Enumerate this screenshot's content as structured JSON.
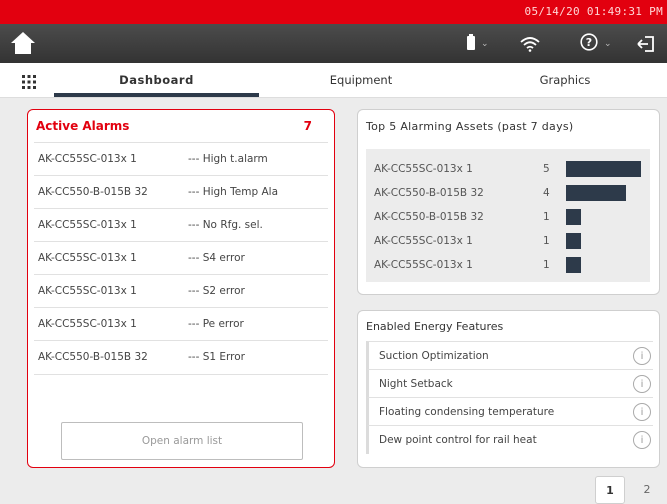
{
  "clock": "05/14/20 01:49:31 PM",
  "colors": {
    "brand_red": "#e2000f",
    "header_dark": "#3b3b3b",
    "bar_navy": "#2d3a4a"
  },
  "toolbar": {
    "home_icon": "home-icon",
    "battery_icon": "battery-icon",
    "wifi_icon": "wifi-icon",
    "help_icon": "help-icon",
    "logout_icon": "logout-icon"
  },
  "tabs": [
    {
      "label": "Dashboard",
      "active": true
    },
    {
      "label": "Equipment",
      "active": false
    },
    {
      "label": "Graphics",
      "active": false
    }
  ],
  "alarms": {
    "title": "Active Alarms",
    "count": "7",
    "rows": [
      {
        "asset": "AK-CC55SC-013x 1",
        "desc": "--- High t.alarm"
      },
      {
        "asset": "AK-CC550-B-015B 32",
        "desc": "--- High Temp Ala"
      },
      {
        "asset": "AK-CC55SC-013x 1",
        "desc": "--- No Rfg. sel."
      },
      {
        "asset": "AK-CC55SC-013x 1",
        "desc": "--- S4 error"
      },
      {
        "asset": "AK-CC55SC-013x 1",
        "desc": "--- S2 error"
      },
      {
        "asset": "AK-CC55SC-013x 1",
        "desc": "--- Pe error"
      },
      {
        "asset": "AK-CC550-B-015B 32",
        "desc": "--- S1 Error"
      }
    ],
    "open_button": "Open alarm list"
  },
  "top5": {
    "title": "Top 5 Alarming Assets (past 7 days)",
    "rows": [
      {
        "name": "AK-CC55SC-013x 1",
        "value": "5"
      },
      {
        "name": "AK-CC550-B-015B 32",
        "value": "4"
      },
      {
        "name": "AK-CC550-B-015B 32",
        "value": "1"
      },
      {
        "name": "AK-CC55SC-013x 1",
        "value": "1"
      },
      {
        "name": "AK-CC55SC-013x 1",
        "value": "1"
      }
    ]
  },
  "energy": {
    "title": "Enabled Energy Features",
    "features": [
      "Suction Optimization",
      "Night Setback",
      "Floating condensing temperature",
      "Dew point control for rail heat"
    ],
    "info_glyph": "i"
  },
  "pagination": {
    "current": "1",
    "next": "2"
  }
}
